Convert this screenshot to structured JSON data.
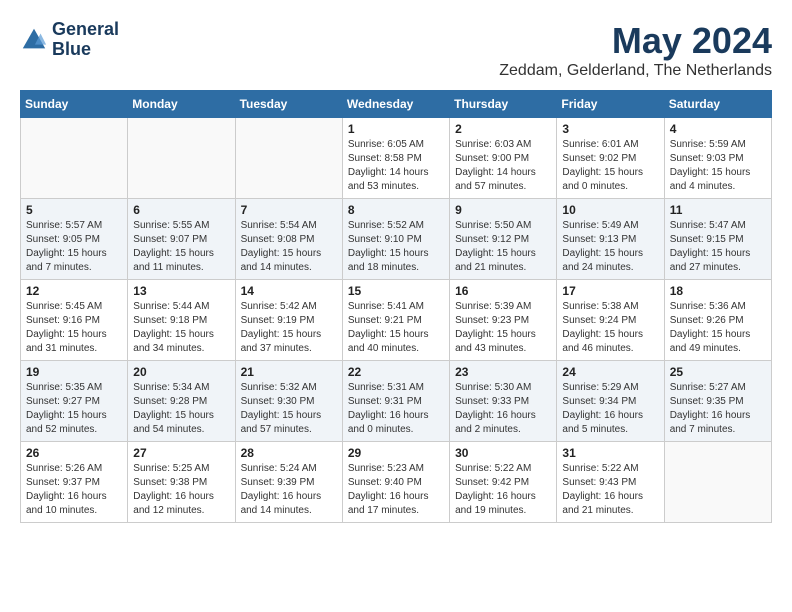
{
  "header": {
    "logo_line1": "General",
    "logo_line2": "Blue",
    "month_year": "May 2024",
    "location": "Zeddam, Gelderland, The Netherlands"
  },
  "weekdays": [
    "Sunday",
    "Monday",
    "Tuesday",
    "Wednesday",
    "Thursday",
    "Friday",
    "Saturday"
  ],
  "weeks": [
    [
      {
        "day": "",
        "info": ""
      },
      {
        "day": "",
        "info": ""
      },
      {
        "day": "",
        "info": ""
      },
      {
        "day": "1",
        "info": "Sunrise: 6:05 AM\nSunset: 8:58 PM\nDaylight: 14 hours\nand 53 minutes."
      },
      {
        "day": "2",
        "info": "Sunrise: 6:03 AM\nSunset: 9:00 PM\nDaylight: 14 hours\nand 57 minutes."
      },
      {
        "day": "3",
        "info": "Sunrise: 6:01 AM\nSunset: 9:02 PM\nDaylight: 15 hours\nand 0 minutes."
      },
      {
        "day": "4",
        "info": "Sunrise: 5:59 AM\nSunset: 9:03 PM\nDaylight: 15 hours\nand 4 minutes."
      }
    ],
    [
      {
        "day": "5",
        "info": "Sunrise: 5:57 AM\nSunset: 9:05 PM\nDaylight: 15 hours\nand 7 minutes."
      },
      {
        "day": "6",
        "info": "Sunrise: 5:55 AM\nSunset: 9:07 PM\nDaylight: 15 hours\nand 11 minutes."
      },
      {
        "day": "7",
        "info": "Sunrise: 5:54 AM\nSunset: 9:08 PM\nDaylight: 15 hours\nand 14 minutes."
      },
      {
        "day": "8",
        "info": "Sunrise: 5:52 AM\nSunset: 9:10 PM\nDaylight: 15 hours\nand 18 minutes."
      },
      {
        "day": "9",
        "info": "Sunrise: 5:50 AM\nSunset: 9:12 PM\nDaylight: 15 hours\nand 21 minutes."
      },
      {
        "day": "10",
        "info": "Sunrise: 5:49 AM\nSunset: 9:13 PM\nDaylight: 15 hours\nand 24 minutes."
      },
      {
        "day": "11",
        "info": "Sunrise: 5:47 AM\nSunset: 9:15 PM\nDaylight: 15 hours\nand 27 minutes."
      }
    ],
    [
      {
        "day": "12",
        "info": "Sunrise: 5:45 AM\nSunset: 9:16 PM\nDaylight: 15 hours\nand 31 minutes."
      },
      {
        "day": "13",
        "info": "Sunrise: 5:44 AM\nSunset: 9:18 PM\nDaylight: 15 hours\nand 34 minutes."
      },
      {
        "day": "14",
        "info": "Sunrise: 5:42 AM\nSunset: 9:19 PM\nDaylight: 15 hours\nand 37 minutes."
      },
      {
        "day": "15",
        "info": "Sunrise: 5:41 AM\nSunset: 9:21 PM\nDaylight: 15 hours\nand 40 minutes."
      },
      {
        "day": "16",
        "info": "Sunrise: 5:39 AM\nSunset: 9:23 PM\nDaylight: 15 hours\nand 43 minutes."
      },
      {
        "day": "17",
        "info": "Sunrise: 5:38 AM\nSunset: 9:24 PM\nDaylight: 15 hours\nand 46 minutes."
      },
      {
        "day": "18",
        "info": "Sunrise: 5:36 AM\nSunset: 9:26 PM\nDaylight: 15 hours\nand 49 minutes."
      }
    ],
    [
      {
        "day": "19",
        "info": "Sunrise: 5:35 AM\nSunset: 9:27 PM\nDaylight: 15 hours\nand 52 minutes."
      },
      {
        "day": "20",
        "info": "Sunrise: 5:34 AM\nSunset: 9:28 PM\nDaylight: 15 hours\nand 54 minutes."
      },
      {
        "day": "21",
        "info": "Sunrise: 5:32 AM\nSunset: 9:30 PM\nDaylight: 15 hours\nand 57 minutes."
      },
      {
        "day": "22",
        "info": "Sunrise: 5:31 AM\nSunset: 9:31 PM\nDaylight: 16 hours\nand 0 minutes."
      },
      {
        "day": "23",
        "info": "Sunrise: 5:30 AM\nSunset: 9:33 PM\nDaylight: 16 hours\nand 2 minutes."
      },
      {
        "day": "24",
        "info": "Sunrise: 5:29 AM\nSunset: 9:34 PM\nDaylight: 16 hours\nand 5 minutes."
      },
      {
        "day": "25",
        "info": "Sunrise: 5:27 AM\nSunset: 9:35 PM\nDaylight: 16 hours\nand 7 minutes."
      }
    ],
    [
      {
        "day": "26",
        "info": "Sunrise: 5:26 AM\nSunset: 9:37 PM\nDaylight: 16 hours\nand 10 minutes."
      },
      {
        "day": "27",
        "info": "Sunrise: 5:25 AM\nSunset: 9:38 PM\nDaylight: 16 hours\nand 12 minutes."
      },
      {
        "day": "28",
        "info": "Sunrise: 5:24 AM\nSunset: 9:39 PM\nDaylight: 16 hours\nand 14 minutes."
      },
      {
        "day": "29",
        "info": "Sunrise: 5:23 AM\nSunset: 9:40 PM\nDaylight: 16 hours\nand 17 minutes."
      },
      {
        "day": "30",
        "info": "Sunrise: 5:22 AM\nSunset: 9:42 PM\nDaylight: 16 hours\nand 19 minutes."
      },
      {
        "day": "31",
        "info": "Sunrise: 5:22 AM\nSunset: 9:43 PM\nDaylight: 16 hours\nand 21 minutes."
      },
      {
        "day": "",
        "info": ""
      }
    ]
  ]
}
